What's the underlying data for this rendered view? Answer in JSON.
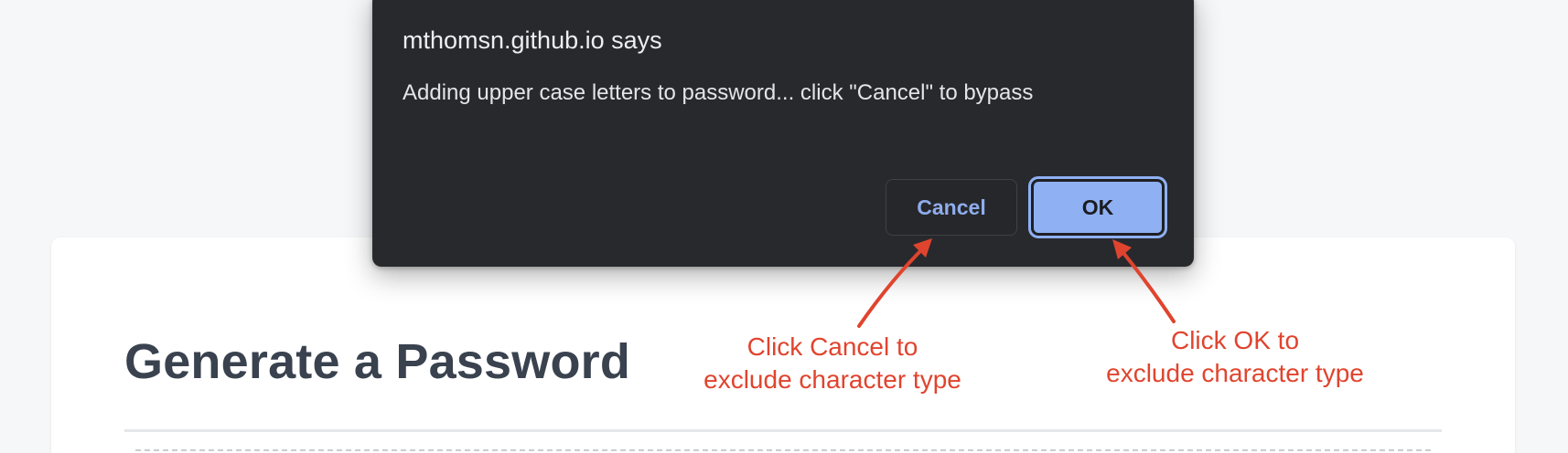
{
  "page": {
    "heading": "Generate a Password"
  },
  "dialog": {
    "origin": "mthomsn.github.io says",
    "message": "Adding upper case letters to password... click \"Cancel\" to bypass",
    "cancel_label": "Cancel",
    "ok_label": "OK"
  },
  "annotations": {
    "cancel_line1": "Click Cancel to",
    "cancel_line2": "exclude character type",
    "ok_line1": "Click OK to",
    "ok_line2": "exclude character type"
  },
  "colors": {
    "annotation": "#e0442e",
    "dialog_bg": "#28292d",
    "accent": "#8fb0f2",
    "heading": "#39424e"
  }
}
